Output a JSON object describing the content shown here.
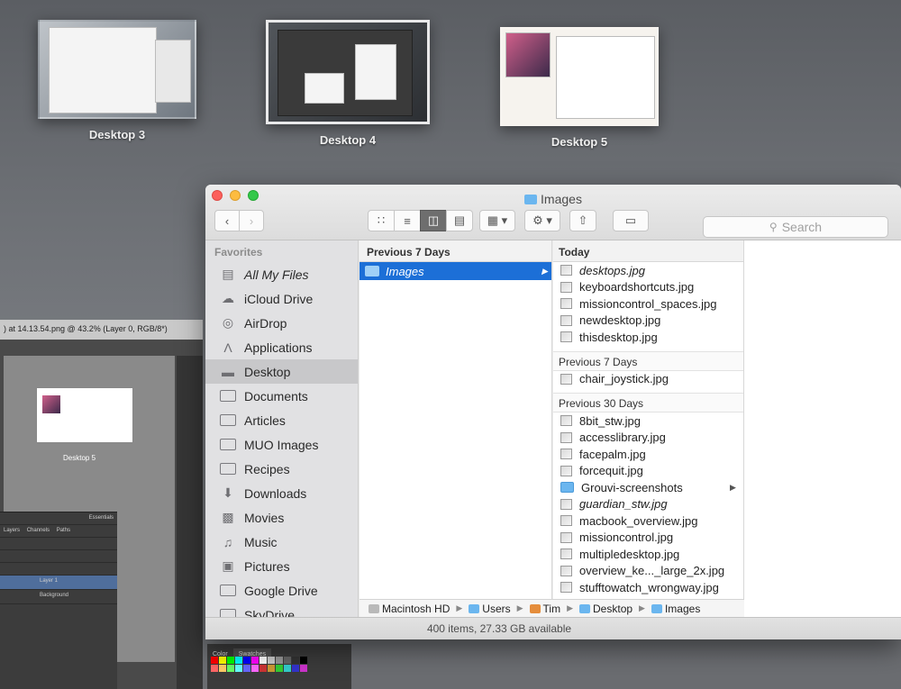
{
  "spaces": [
    {
      "label": "Desktop 3"
    },
    {
      "label": "Desktop 4"
    },
    {
      "label": "Desktop 5"
    }
  ],
  "photoshop": {
    "title": ") at 14.13.54.png @ 43.2% (Layer 0, RGB/8*)",
    "doc_label": "Desktop 5",
    "layers_tab": "Layers",
    "channels_tab": "Channels",
    "paths_tab": "Paths",
    "essentials": "Essentials",
    "layer1": "Layer 1",
    "background": "Background",
    "color_tab": "Color",
    "swatches_tab": "Swatches"
  },
  "finder": {
    "title": "Images",
    "search_placeholder": "Search",
    "sidebar": {
      "heading": "Favorites",
      "items": [
        {
          "label": "All My Files",
          "icon": "all-files-icon"
        },
        {
          "label": "iCloud Drive",
          "icon": "cloud-icon"
        },
        {
          "label": "AirDrop",
          "icon": "airdrop-icon"
        },
        {
          "label": "Applications",
          "icon": "applications-icon"
        },
        {
          "label": "Desktop",
          "icon": "desktop-icon"
        },
        {
          "label": "Documents",
          "icon": "folder-icon"
        },
        {
          "label": "Articles",
          "icon": "folder-icon"
        },
        {
          "label": "MUO Images",
          "icon": "folder-icon"
        },
        {
          "label": "Recipes",
          "icon": "folder-icon"
        },
        {
          "label": "Downloads",
          "icon": "download-icon"
        },
        {
          "label": "Movies",
          "icon": "movies-icon"
        },
        {
          "label": "Music",
          "icon": "music-icon"
        },
        {
          "label": "Pictures",
          "icon": "camera-icon"
        },
        {
          "label": "Google Drive",
          "icon": "folder-icon"
        },
        {
          "label": "SkyDrive",
          "icon": "folder-icon"
        }
      ]
    },
    "col1": {
      "heading": "Previous 7 Days",
      "selected": "Images"
    },
    "col2": {
      "groups": [
        {
          "heading": "Today",
          "files": [
            "desktops.jpg",
            "keyboardshortcuts.jpg",
            "missioncontrol_spaces.jpg",
            "newdesktop.jpg",
            "thisdesktop.jpg"
          ]
        },
        {
          "heading": "Previous 7 Days",
          "files": [
            "chair_joystick.jpg"
          ]
        },
        {
          "heading": "Previous 30 Days",
          "files": [
            "8bit_stw.jpg",
            "accesslibrary.jpg",
            "facepalm.jpg",
            "forcequit.jpg",
            "Grouvi-screenshots",
            "guardian_stw.jpg",
            "macbook_overview.jpg",
            "missioncontrol.jpg",
            "multipledesktop.jpg",
            "overview_ke..._large_2x.jpg",
            "stufftowatch_wrongway.jpg"
          ]
        }
      ]
    },
    "pathbar": [
      "Macintosh HD",
      "Users",
      "Tim",
      "Desktop",
      "Images"
    ],
    "status": "400 items, 27.33 GB available"
  }
}
